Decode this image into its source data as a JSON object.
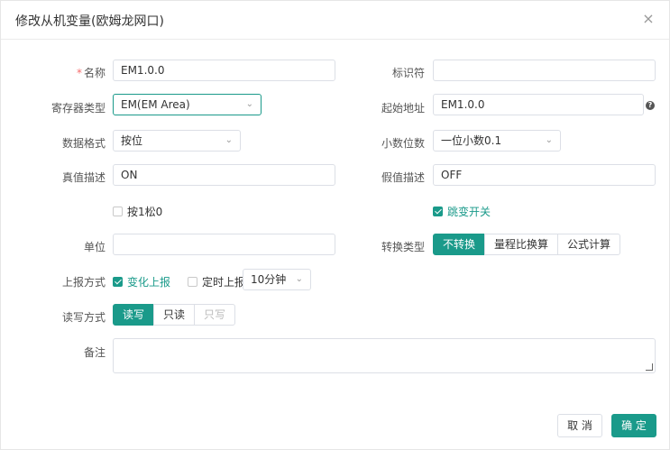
{
  "dialog": {
    "title": "修改从机变量(欧姆龙网口)",
    "close_icon": "×"
  },
  "form": {
    "name": {
      "label": "名称",
      "required_mark": "*",
      "value": "EM1.0.0"
    },
    "identifier": {
      "label": "标识符",
      "value": ""
    },
    "register_type": {
      "label": "寄存器类型",
      "value": "EM(EM Area)"
    },
    "start_address": {
      "label": "起始地址",
      "value": "EM1.0.0",
      "help": "?"
    },
    "data_format": {
      "label": "数据格式",
      "value": "按位"
    },
    "decimal_places": {
      "label": "小数位数",
      "value": "一位小数0.1"
    },
    "true_desc": {
      "label": "真值描述",
      "value": "ON"
    },
    "false_desc": {
      "label": "假值描述",
      "value": "OFF"
    },
    "press1_release0": {
      "label": "按1松0",
      "checked": false
    },
    "toggle_switch": {
      "label": "跳变开关",
      "checked": true
    },
    "unit": {
      "label": "单位",
      "value": ""
    },
    "conversion_type": {
      "label": "转换类型",
      "options": [
        "不转换",
        "量程比换算",
        "公式计算"
      ],
      "selected": "不转换"
    },
    "report_mode": {
      "label": "上报方式",
      "on_change": {
        "label": "变化上报",
        "checked": true
      },
      "timed": {
        "label": "定时上报",
        "checked": false
      },
      "interval": "10分钟"
    },
    "rw_mode": {
      "label": "读写方式",
      "options": [
        "读写",
        "只读",
        "只写"
      ],
      "selected": "读写"
    },
    "remark": {
      "label": "备注",
      "value": ""
    }
  },
  "footer": {
    "cancel_label": "取 消",
    "ok_label": "确 定"
  },
  "colors": {
    "accent": "#1a9a8a",
    "required": "#f56c6c",
    "border": "#dcdfe6"
  },
  "icons": {
    "close": "close-icon",
    "chevron": "chevron-down-icon",
    "help": "question-icon",
    "check": "check-icon"
  }
}
